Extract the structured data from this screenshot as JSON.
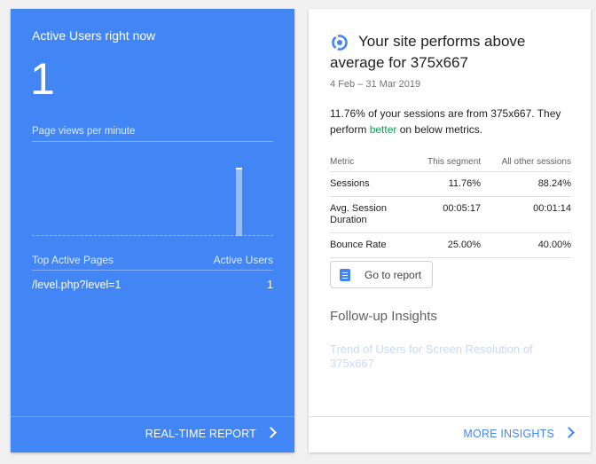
{
  "realtime": {
    "title": "Active Users right now",
    "active_users": "1",
    "pageviews_label": "Page views per minute",
    "pageviews_bar_level": 0.8,
    "top_pages_header": "Top Active Pages",
    "active_users_header": "Active Users",
    "pages": [
      {
        "page": "/level.php?level=1",
        "users": "1"
      }
    ],
    "report_link": "REAL-TIME REPORT",
    "colors": {
      "background": "#4285f4"
    }
  },
  "insight": {
    "icon": "insights-icon",
    "title": "Your site performs above average for 375x667",
    "date_range": "4 Feb – 31 Mar 2019",
    "summary_prefix": "11.76% of your sessions are from 375x667. They perform ",
    "summary_highlight": "better",
    "summary_suffix": " on below metrics.",
    "table_headers": [
      "Metric",
      "This segment",
      "All other sessions"
    ],
    "rows": [
      {
        "metric": "Sessions",
        "segment": "11.76%",
        "other": "88.24%"
      },
      {
        "metric": "Avg. Session Duration",
        "segment": "00:05:17",
        "other": "00:01:14"
      },
      {
        "metric": "Bounce Rate",
        "segment": "25.00%",
        "other": "40.00%"
      }
    ],
    "go_to_report": "Go to report",
    "followup_title": "Follow-up Insights",
    "followup_link": "Trend of Users for Screen Resolution of 375x667",
    "more_insights": "MORE INSIGHTS",
    "colors": {
      "accent": "#4285f4",
      "positive": "#0f9d58"
    }
  }
}
